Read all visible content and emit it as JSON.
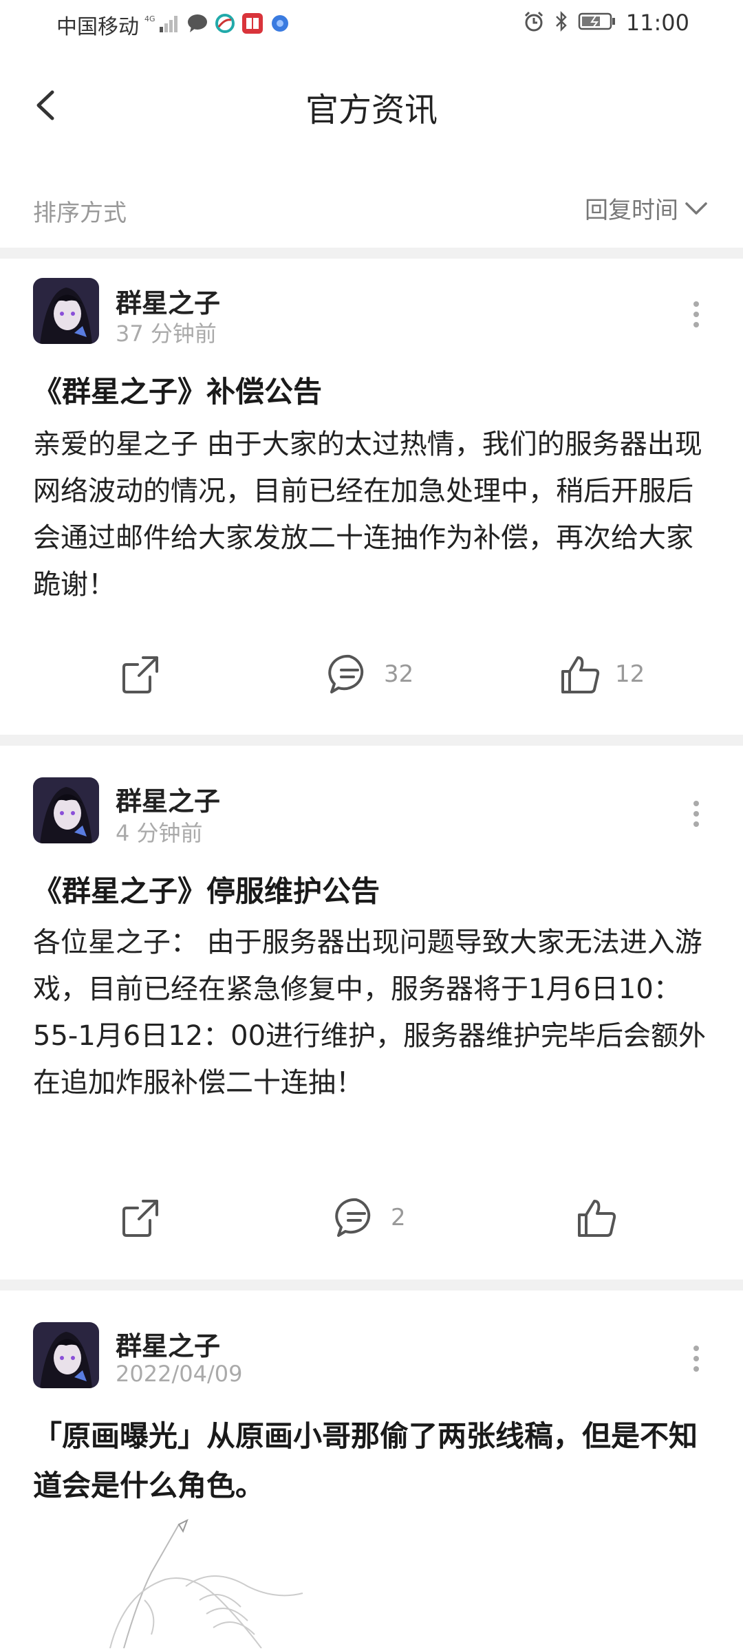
{
  "status": {
    "carrier": "中国移动",
    "network": "4G",
    "time": "11:00"
  },
  "header": {
    "title": "官方资讯"
  },
  "sort": {
    "label": "排序方式",
    "value": "回复时间"
  },
  "posts": [
    {
      "author": "群星之子",
      "time": "37 分钟前",
      "title": "《群星之子》补偿公告",
      "body": "亲爱的星之子 由于大家的太过热情，我们的服务器出现网络波动的情况，目前已经在加急处理中，稍后开服后会通过邮件给大家发放二十连抽作为补偿，再次给大家跪谢！",
      "comments": "32",
      "likes": "12"
    },
    {
      "author": "群星之子",
      "time": "4 分钟前",
      "title": "《群星之子》停服维护公告",
      "body": "各位星之子： 由于服务器出现问题导致大家无法进入游戏，目前已经在紧急修复中，服务器将于1月6日10：55-1月6日12：00进行维护，服务器维护完毕后会额外在追加炸服补偿二十连抽！",
      "comments": "2",
      "likes": ""
    },
    {
      "author": "群星之子",
      "time": "2022/04/09",
      "title": "「原画曝光」从原画小哥那偷了两张线稿，但是不知道会是什么角色。"
    }
  ],
  "icons": {
    "back": "chevron-left-icon",
    "sort": "chevron-down-icon",
    "more": "more-vertical-icon",
    "share": "share-icon",
    "comment": "comment-icon",
    "like": "thumbs-up-icon"
  }
}
